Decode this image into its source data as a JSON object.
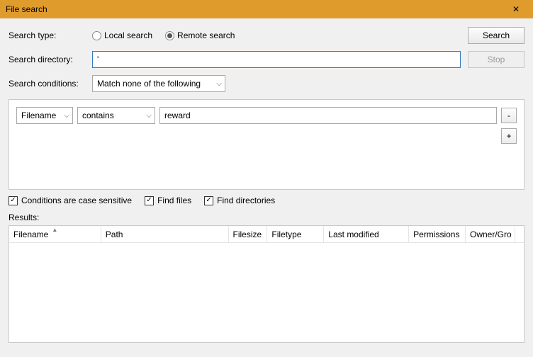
{
  "window": {
    "title": "File search"
  },
  "labels": {
    "search_type": "Search type:",
    "search_directory": "Search directory:",
    "search_conditions": "Search conditions:",
    "results": "Results:"
  },
  "radios": {
    "local": "Local search",
    "remote": "Remote search",
    "selected": "remote"
  },
  "buttons": {
    "search": "Search",
    "stop": "Stop",
    "remove": "-",
    "add": "+"
  },
  "inputs": {
    "directory_value": "'"
  },
  "condition_mode": "Match none of the following",
  "condition_rule": {
    "field": "Filename",
    "operator": "contains",
    "value": "reward"
  },
  "checks": {
    "case_sensitive": {
      "label": "Conditions are case sensitive",
      "checked": true
    },
    "find_files": {
      "label": "Find files",
      "checked": true
    },
    "find_dirs": {
      "label": "Find directories",
      "checked": true
    }
  },
  "columns": {
    "filename": "Filename",
    "path": "Path",
    "filesize": "Filesize",
    "filetype": "Filetype",
    "last_modified": "Last modified",
    "permissions": "Permissions",
    "owner_group": "Owner/Gro"
  }
}
